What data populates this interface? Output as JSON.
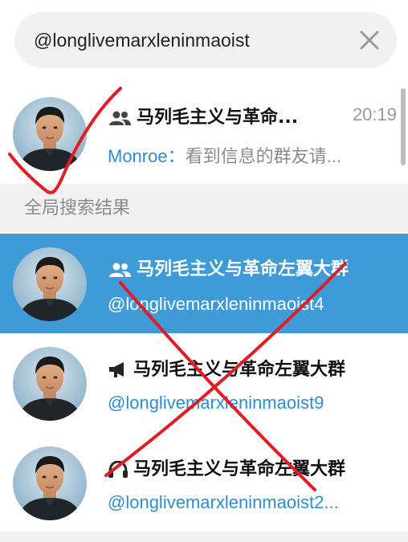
{
  "search": {
    "value": "@longlivemarxleninmaoist"
  },
  "top_result": {
    "title": "马列毛主义与革命...",
    "time": "20:19",
    "sender": "Monroe",
    "separator": "：",
    "preview": "看到信息的群友请..."
  },
  "section": {
    "title": "全局搜索结果"
  },
  "results": [
    {
      "title": "马列毛主义与革命左翼大群",
      "handle": "@longlivemarxleninmaoist4",
      "type": "group-icon",
      "selected": true
    },
    {
      "title": "马列毛主义与革命左翼大群",
      "handle": "@longlivemarxleninmaoist9",
      "type": "megaphone-icon",
      "selected": false
    },
    {
      "title": "马列毛主义与革命左翼大群",
      "handle": "@longlivemarxleninmaoist2...",
      "type": "headset-icon",
      "selected": false
    }
  ],
  "colors": {
    "accent": "#3f9ad8",
    "link": "#2f8dd0",
    "annotation": "#e21b24",
    "section_bg": "#f1f1f1"
  }
}
